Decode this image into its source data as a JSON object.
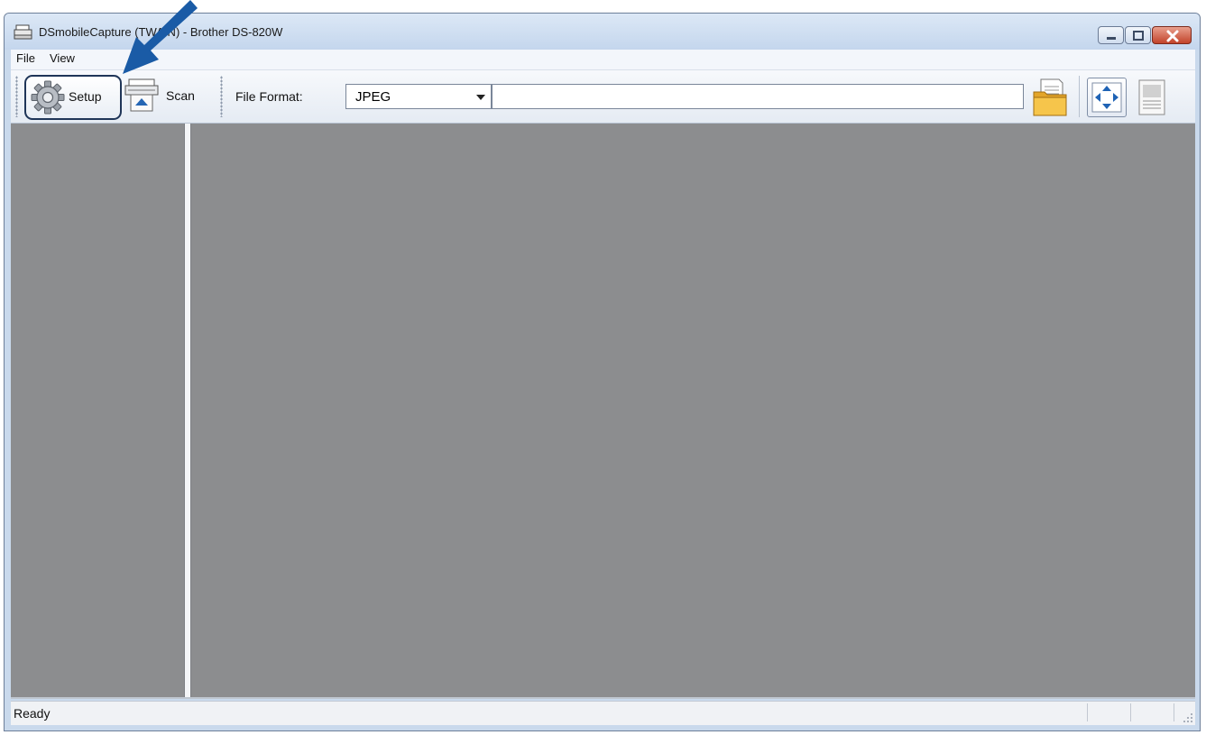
{
  "window": {
    "title": "DSmobileCapture (TWAIN) - Brother DS-820W",
    "icon": "scanner-icon",
    "controls": [
      "minimize-icon",
      "maximize-icon",
      "close-icon"
    ]
  },
  "menu": {
    "items": [
      {
        "label": "File"
      },
      {
        "label": "View"
      }
    ]
  },
  "toolbar": {
    "setup_label": "Setup",
    "scan_label": "Scan",
    "file_format_label": "File Format:",
    "file_format_value": "JPEG",
    "file_path_value": "",
    "icons": [
      "gear-icon",
      "scan-icon",
      "folder-icon",
      "fit-to-window-icon",
      "actual-size-page-icon"
    ]
  },
  "status": {
    "text": "Ready"
  },
  "colors": {
    "callout_arrow": "#1a5ba6",
    "pane_background": "#8c8d8f",
    "close_button": "#c2432a"
  }
}
